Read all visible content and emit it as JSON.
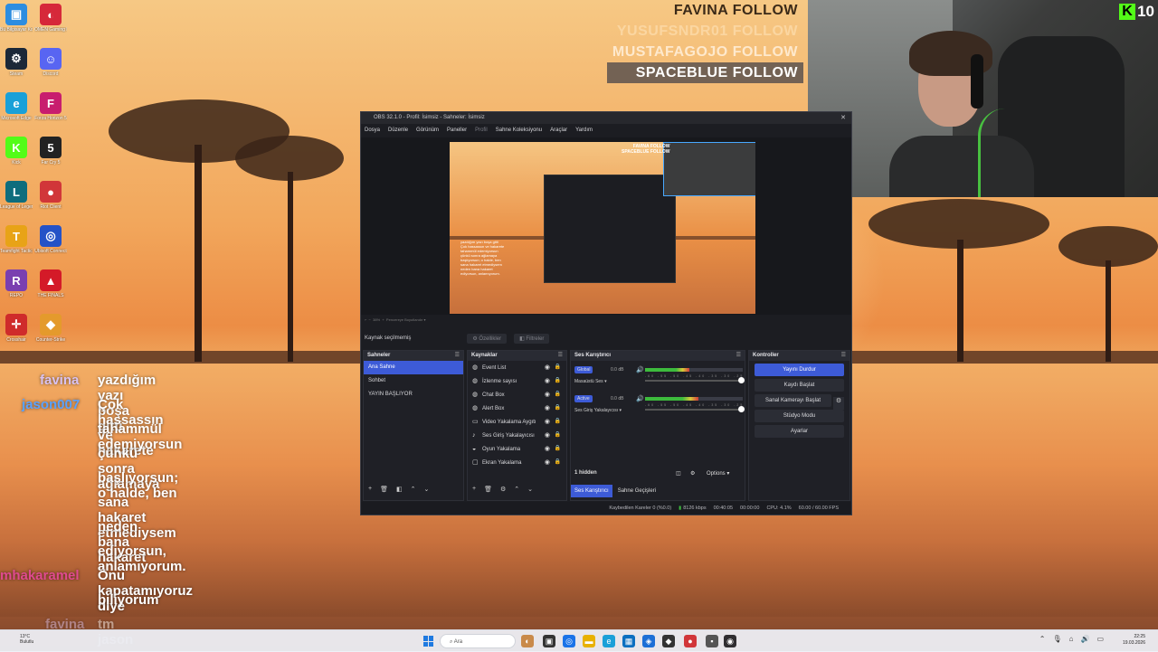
{
  "follow_overlay": [
    {
      "name": "FAVINA",
      "action": "FOLLOW"
    },
    {
      "name": "YUSUFSNDR01",
      "action": "FOLLOW"
    },
    {
      "name": "MUSTAFAGOJO",
      "action": "FOLLOW"
    },
    {
      "name": "SPACEBLUE",
      "action": "FOLLOW"
    }
  ],
  "webcam": {
    "viewer_count": "10",
    "platform_icon": "kick-icon"
  },
  "desktop_icons": [
    {
      "label": "Bu Bilgisayar Kısayol",
      "icon": "computer-icon",
      "color": "#2d8de0"
    },
    {
      "label": "OMEN Gaming Hub",
      "icon": "omen-icon",
      "color": "#d6283a"
    },
    {
      "label": "Steam",
      "icon": "steam-icon",
      "color": "#1b2838"
    },
    {
      "label": "Discord",
      "icon": "discord-icon",
      "color": "#5865f2"
    },
    {
      "label": "Microsoft Edge",
      "icon": "edge-icon",
      "color": "#1aa0d8"
    },
    {
      "label": "Forza Horizon 5",
      "icon": "forza-icon",
      "color": "#c81d6e"
    },
    {
      "label": "Kick",
      "icon": "kick-app-icon",
      "color": "#53fc18"
    },
    {
      "label": "Far Cry 5",
      "icon": "farcry-icon",
      "color": "#222"
    },
    {
      "label": "League of Legends",
      "icon": "league-icon",
      "color": "#0e6d7d"
    },
    {
      "label": "Riot Client",
      "icon": "riot-icon",
      "color": "#d13639"
    },
    {
      "label": "Teamfight Tactics",
      "icon": "tft-icon",
      "color": "#e8a317"
    },
    {
      "label": "Ubisoft Connect",
      "icon": "ubisoft-icon",
      "color": "#2452c7"
    },
    {
      "label": "REPO",
      "icon": "repo-icon",
      "color": "#7a3fb0"
    },
    {
      "label": "THE FINALS",
      "icon": "finals-icon",
      "color": "#d41a28"
    },
    {
      "label": "Crosshair",
      "icon": "crosshair-icon",
      "color": "#cf2b2b"
    },
    {
      "label": "Counter-Strike",
      "icon": "cs-icon",
      "color": "#e49a2c"
    }
  ],
  "chat": [
    {
      "user": "favina",
      "message": "yazdığım yazı boşa gitti",
      "user_color": "#d9c2f0"
    },
    {
      "user": "jason007",
      "message": "Çok hassassın ve hakarete",
      "user_color": "#5aa2ff"
    },
    {
      "user": "",
      "message": "tahammül edemiyorsun",
      "user_color": "#ffffff"
    },
    {
      "user": "",
      "message": "çünkü sonra ağlamaya",
      "user_color": "#ffffff"
    },
    {
      "user": "",
      "message": "başlıyorsun; o halde, ben",
      "user_color": "#ffffff"
    },
    {
      "user": "",
      "message": "sana hakaret etmediysem",
      "user_color": "#ffffff"
    },
    {
      "user": "",
      "message": "neden bana hakaret",
      "user_color": "#ffffff"
    },
    {
      "user": "",
      "message": "ediyorsun, anlamıyorum.",
      "user_color": "#ffffff"
    },
    {
      "user": "mhakaramel",
      "message": "Onu kapatamıyoruz diye",
      "user_color": "#e04a8f"
    },
    {
      "user": "",
      "message": "biliyorum",
      "user_color": "#ffffff"
    },
    {
      "user": "favina",
      "message": "tm jason",
      "user_color": "#d9c2f0"
    }
  ],
  "obs": {
    "title": "OBS 32.1.0 - Profil: İsimsiz - Sahneler: İsimsiz",
    "menu": [
      "Dosya",
      "Düzenle",
      "Görünüm",
      "Paneller",
      "Profil",
      "Sahne Koleksiyonu",
      "Araçlar",
      "Yardım"
    ],
    "preview_overlay": {
      "follow_1": "FAVINA FOLLOW",
      "follow_2": "SPACEBLUE FOLLOW"
    },
    "scale_label": "Pencereye Boyutlandır",
    "source_bar": {
      "selected": "Kaynak seçilmemiş",
      "properties": "Özellikler",
      "filters": "Filtreler"
    },
    "scenes": {
      "title": "Sahneler",
      "items": [
        "Ana Sahne",
        "Sohbet",
        "YAYIN BAŞLIYOR"
      ],
      "active_index": 0
    },
    "sources": {
      "title": "Kaynaklar",
      "items": [
        {
          "label": "Event List",
          "icon": "browser-icon"
        },
        {
          "label": "İzlenme sayısı",
          "icon": "browser-icon"
        },
        {
          "label": "Chat Box",
          "icon": "browser-icon"
        },
        {
          "label": "Alert Box",
          "icon": "browser-icon"
        },
        {
          "label": "Video Yakalama Aygıtı",
          "icon": "camera-icon"
        },
        {
          "label": "Ses Giriş Yakalayıcısı",
          "icon": "mic-icon"
        },
        {
          "label": "Oyun Yakalama",
          "icon": "gamepad-icon"
        },
        {
          "label": "Ekran Yakalama",
          "icon": "monitor-icon"
        }
      ]
    },
    "mixer": {
      "title": "Ses Karıştırıcı",
      "channels": [
        {
          "badge": "Global",
          "name": "Masaüstü Ses",
          "db": "0.0 dB",
          "level": 0.45,
          "badge_color": "#3d5bd7"
        },
        {
          "badge": "Active",
          "name": "Ses Giriş Yakalayıcısı",
          "db": "0.0 dB",
          "level": 0.55,
          "badge_color": "#3d5bd7"
        }
      ],
      "scale": "-60 -55 -50 -45 -40 -35 -30 -25 -20 -15 -10 -5 0",
      "hidden": "1 hidden",
      "options": "Options",
      "tabs": [
        "Ses Karıştırıcı",
        "Sahne Geçişleri"
      ]
    },
    "controls": {
      "title": "Kontroller",
      "buttons": [
        "Yayını Durdur",
        "Kaydı Başlat",
        "Sanal Kamerayı Başlat",
        "Stüdyo Modu",
        "Ayarlar"
      ]
    },
    "status": {
      "dropped": "Kaybedilen Kareler 0 (%0.0)",
      "kbps": "8126 kbps",
      "time1": "00:40:05",
      "time2": "00:00:00",
      "cpu": "CPU: 4.1%",
      "fps": "60.00 / 60.00 FPS"
    }
  },
  "taskbar": {
    "weather_temp": "13°C",
    "weather_desc": "Bulutlu",
    "search_placeholder": "Ara",
    "time": "22:25",
    "date": "19.03.2026"
  }
}
